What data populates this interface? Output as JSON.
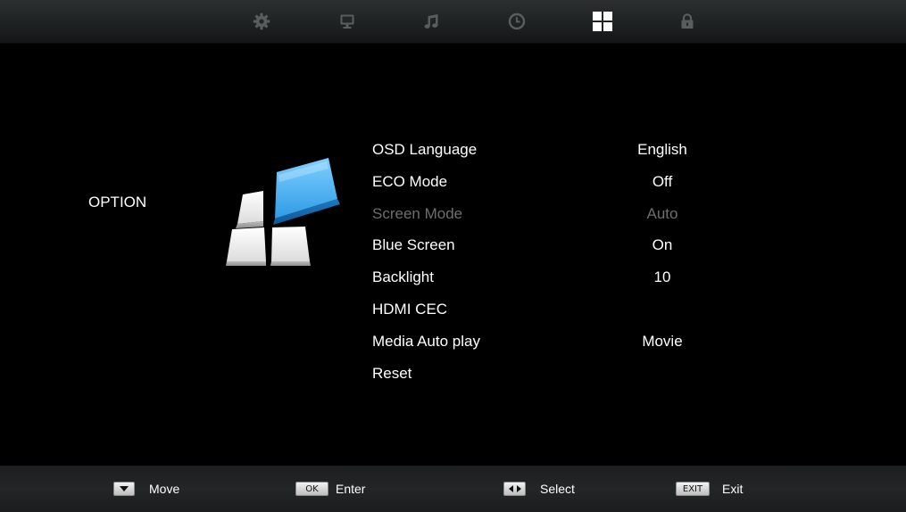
{
  "tabs": [
    {
      "id": "picture",
      "icon": "gear-icon",
      "active": false
    },
    {
      "id": "screen",
      "icon": "monitor-icon",
      "active": false
    },
    {
      "id": "sound",
      "icon": "music-note-icon",
      "active": false
    },
    {
      "id": "time",
      "icon": "clock-icon",
      "active": false
    },
    {
      "id": "option",
      "icon": "grid-icon",
      "active": true
    },
    {
      "id": "lock",
      "icon": "lock-icon",
      "active": false
    }
  ],
  "category": {
    "title": "OPTION",
    "icon": "option-blocks-icon"
  },
  "menu": {
    "items": [
      {
        "label": "OSD Language",
        "value": "English",
        "enabled": true
      },
      {
        "label": "ECO Mode",
        "value": "Off",
        "enabled": true
      },
      {
        "label": "Screen Mode",
        "value": "Auto",
        "enabled": false
      },
      {
        "label": "Blue Screen",
        "value": "On",
        "enabled": true
      },
      {
        "label": "Backlight",
        "value": "10",
        "enabled": true
      },
      {
        "label": "HDMI CEC",
        "value": "",
        "enabled": true
      },
      {
        "label": "Media Auto play",
        "value": "Movie",
        "enabled": true
      },
      {
        "label": "Reset",
        "value": "",
        "enabled": true
      }
    ]
  },
  "footer": {
    "move": {
      "key_icon": "down-arrow-key-icon",
      "label": "Move"
    },
    "enter": {
      "key": "OK",
      "label": "Enter"
    },
    "select": {
      "key_icon": "left-right-arrow-key-icon",
      "label": "Select"
    },
    "exit": {
      "key": "EXIT",
      "label": "Exit"
    }
  },
  "colors": {
    "icon_inactive": "#5a5d5e",
    "icon_active": "#ffffff",
    "text": "#ffffff",
    "text_disabled": "#6e6e6e",
    "accent_blue": "#2f9be6"
  }
}
